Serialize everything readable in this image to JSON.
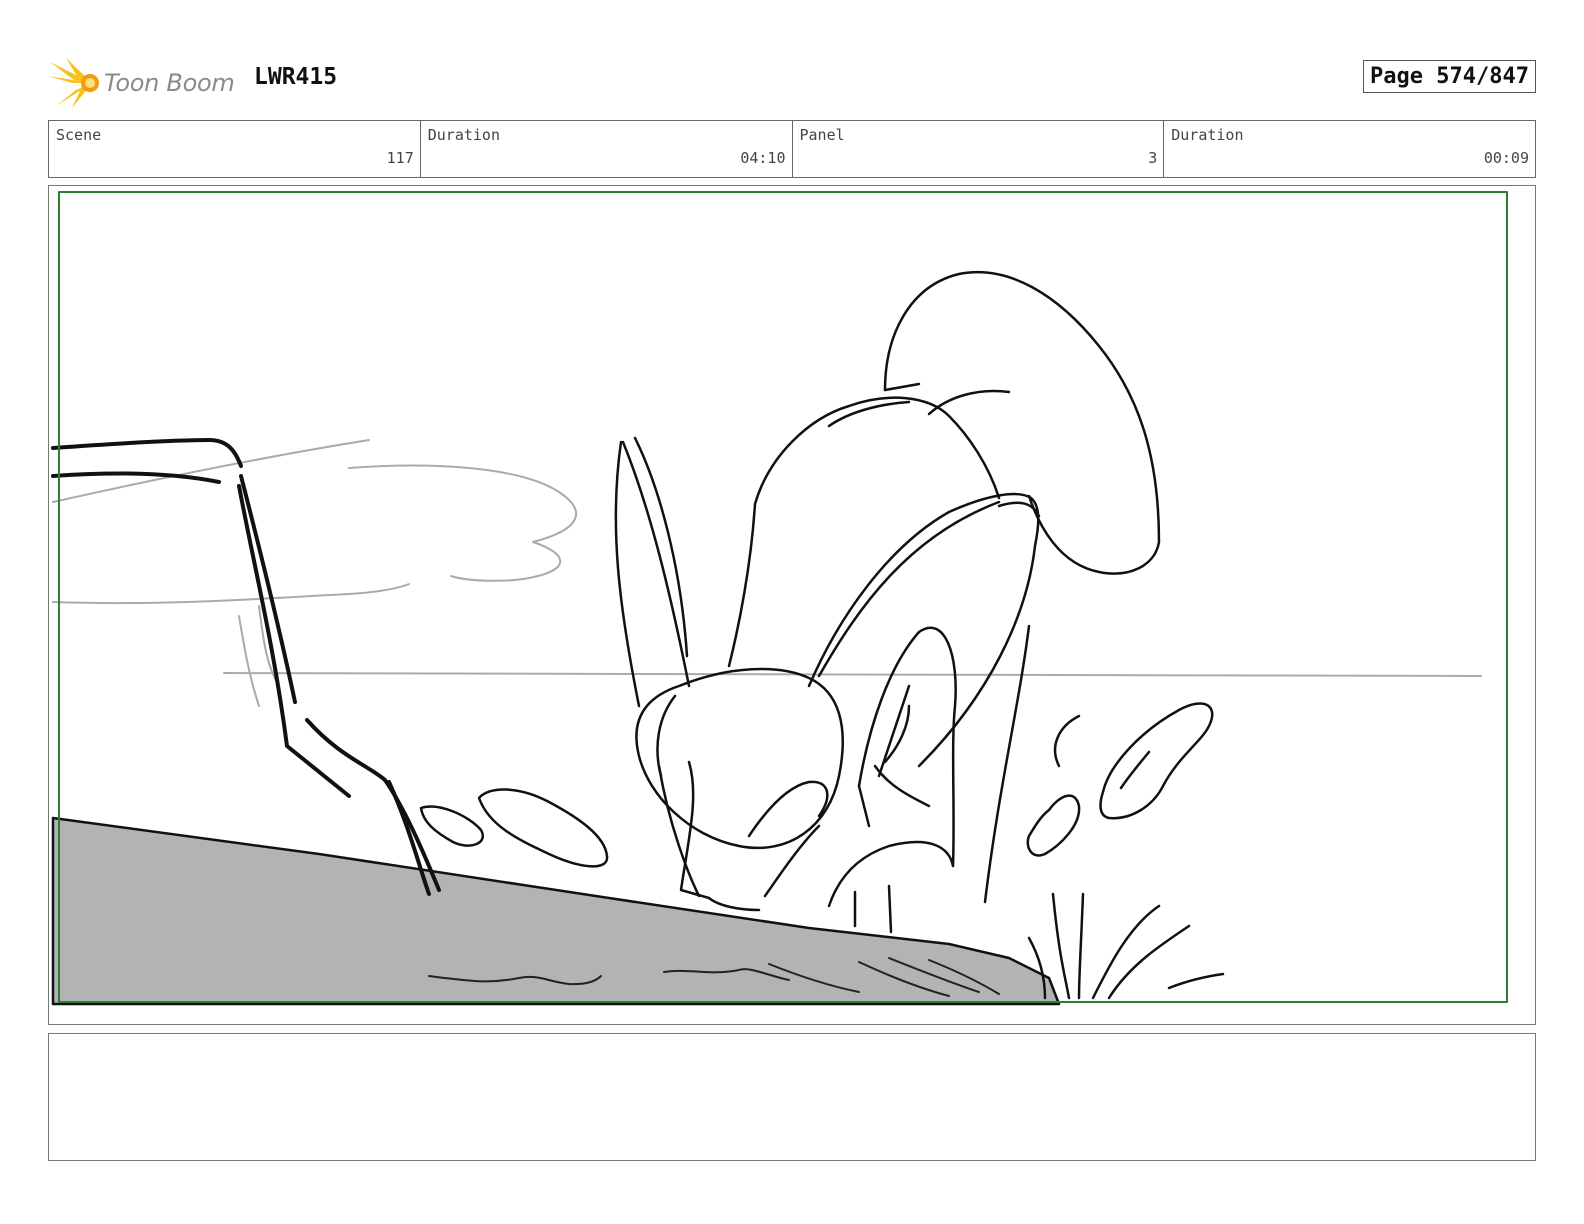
{
  "header": {
    "logo_text": "Toon Boom",
    "project_code": "LWR415",
    "page_label": "Page 574/847"
  },
  "info": {
    "scene_label": "Scene",
    "scene_value": "117",
    "scene_duration_label": "Duration",
    "scene_duration_value": "04:10",
    "panel_label": "Panel",
    "panel_value": "3",
    "panel_duration_label": "Duration",
    "panel_duration_value": "00:09"
  },
  "colors": {
    "safe_frame": "#2e7d32",
    "ground": "#b3b3b3",
    "logo_accent": "#f6c21c"
  },
  "icons": {
    "logo": "starburst-icon"
  }
}
